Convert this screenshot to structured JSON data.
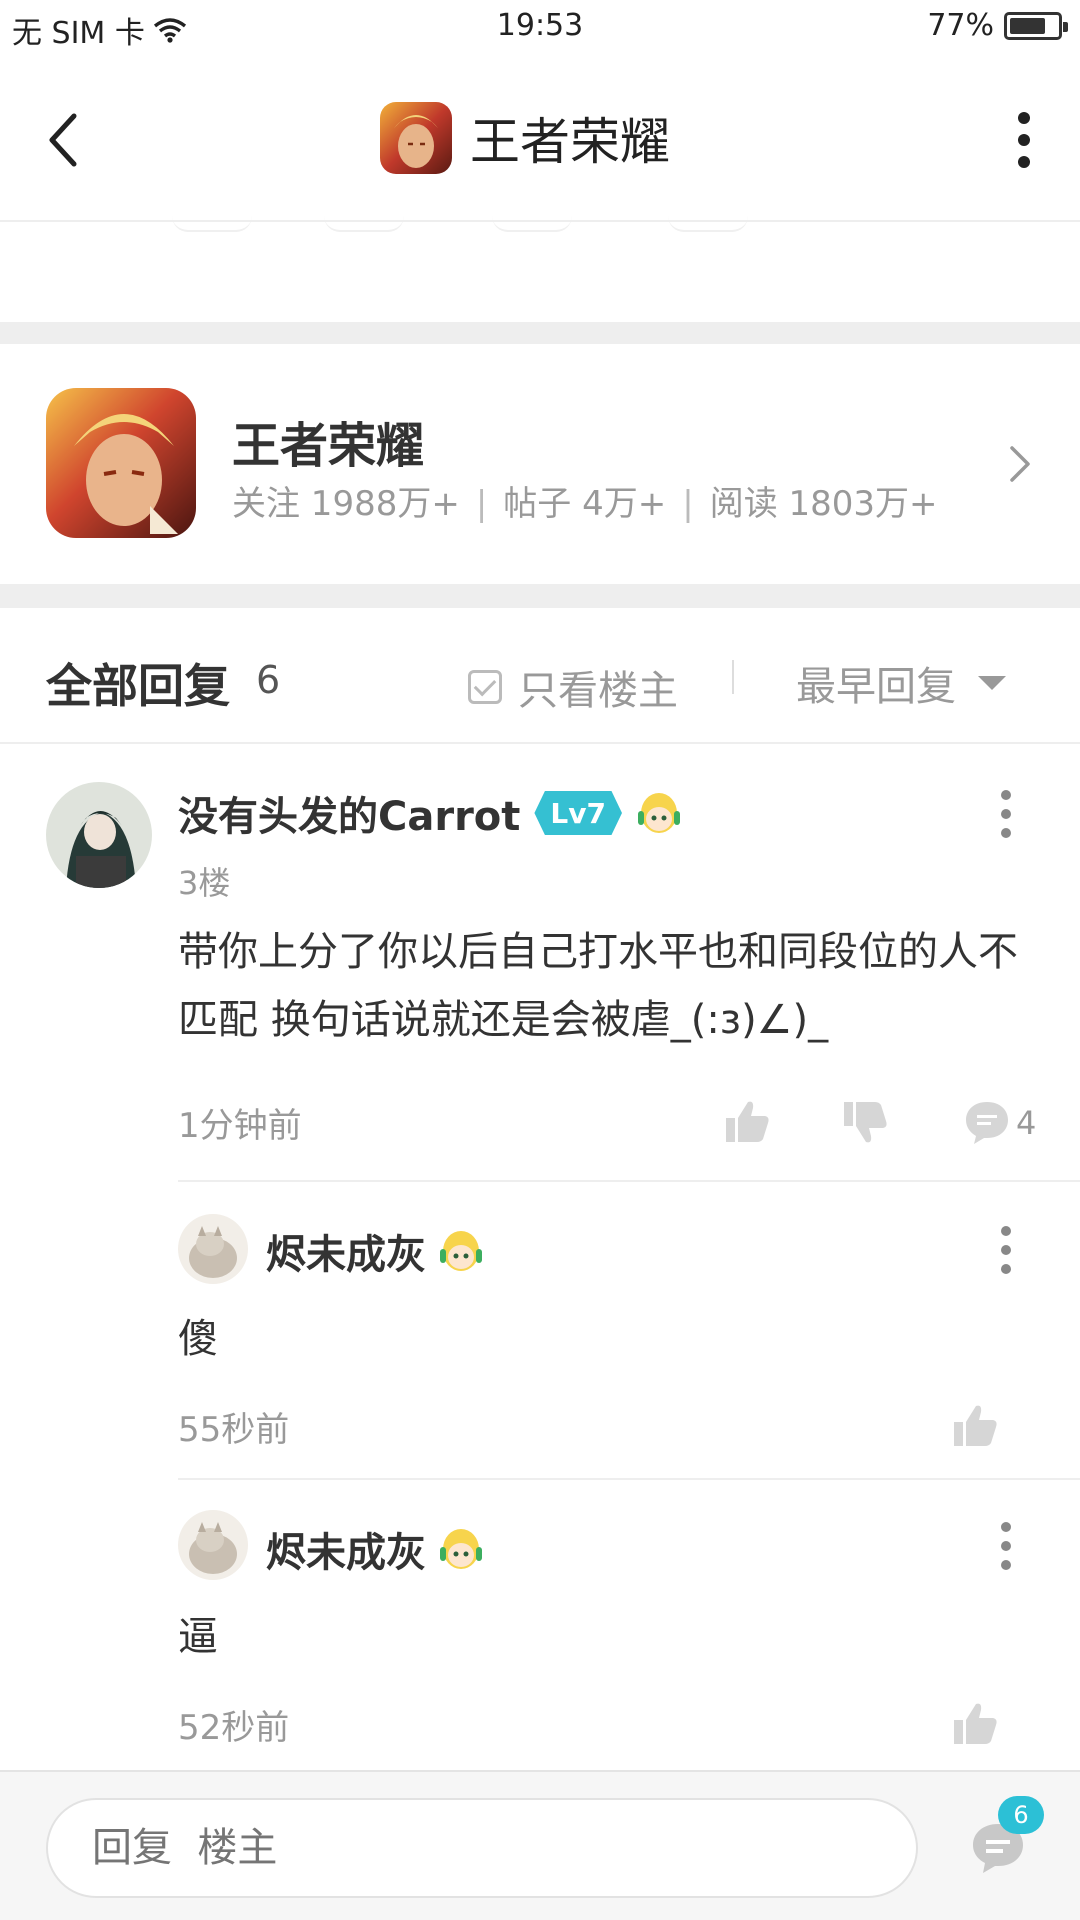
{
  "status_bar": {
    "carrier": "无 SIM 卡",
    "time": "19:53",
    "battery": "77%",
    "battery_level": 0.77
  },
  "nav": {
    "title": "王者荣耀"
  },
  "forum": {
    "name": "王者荣耀",
    "follow": "关注 1988万+",
    "posts": "帖子 4万+",
    "reads": "阅读 1803万+",
    "separator": "|"
  },
  "replies_header": {
    "title": "全部回复",
    "count": "6",
    "only_op": "只看楼主",
    "sort": "最早回复"
  },
  "comment": {
    "user": "没有头发的Carrot",
    "level": "Lv7",
    "floor": "3楼",
    "text": "带你上分了你以后自己打水平也和同段位的人不匹配 换句话说就还是会被虐_(:з)∠)_",
    "time": "1分钟前",
    "reply_count": "4",
    "sub_replies": [
      {
        "user": "烬未成灰",
        "text": "傻",
        "time": "55秒前"
      },
      {
        "user": "烬未成灰",
        "text": "逼",
        "time": "52秒前"
      }
    ]
  },
  "bottom_bar": {
    "placeholder": "回复  楼主",
    "badge": "6"
  },
  "colors": {
    "accent": "#35c0d2",
    "text_primary": "#333333",
    "text_secondary": "#999999",
    "divider": "#eeeeee"
  }
}
